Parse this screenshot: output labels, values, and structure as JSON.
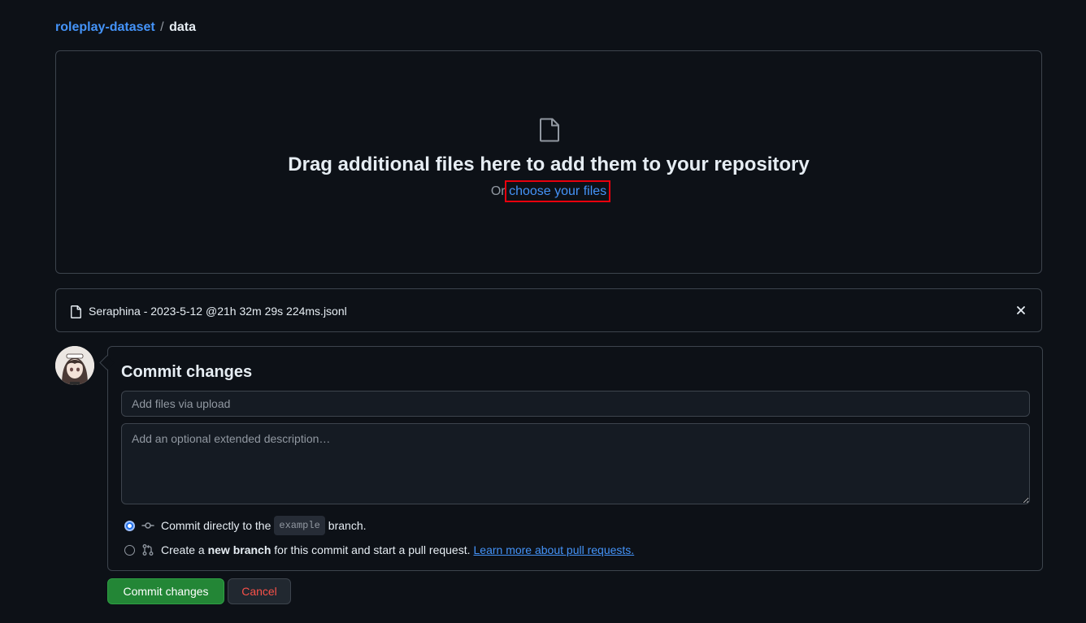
{
  "breadcrumb": {
    "repo": "roleplay-dataset",
    "separator": "/",
    "current": "data"
  },
  "dropzone": {
    "title": "Drag additional files here to add them to your repository",
    "prefix": "Or",
    "link": "choose your files",
    "icon": "file-icon"
  },
  "uploaded_file": {
    "name": "Seraphina - 2023-5-12 @21h 32m 29s 224ms.jsonl",
    "icon": "file-icon",
    "remove_icon": "close-icon"
  },
  "commit": {
    "title": "Commit changes",
    "summary_placeholder": "Add files via upload",
    "description_placeholder": "Add an optional extended description…",
    "option_direct": {
      "before": "Commit directly to the",
      "branch": "example",
      "after": "branch.",
      "selected": true
    },
    "option_new_branch": {
      "before": "Create a",
      "bold": "new branch",
      "after": "for this commit and start a pull request.",
      "link": "Learn more about pull requests.",
      "selected": false
    }
  },
  "buttons": {
    "commit": "Commit changes",
    "cancel": "Cancel"
  },
  "colors": {
    "background": "#0d1117",
    "accent_link": "#4493f8",
    "commit_button": "#238636",
    "cancel_text": "#f85149",
    "highlight_box": "#e8000d"
  }
}
